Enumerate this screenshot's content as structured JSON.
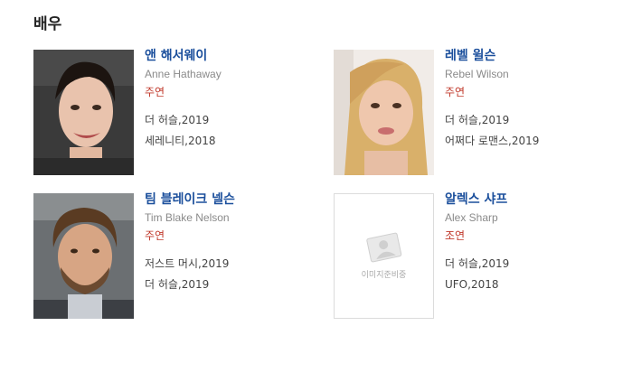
{
  "section": {
    "title": "배우"
  },
  "cast": [
    {
      "name_ko": "앤 해서웨이",
      "name_en": "Anne Hathaway",
      "role": "주연",
      "films": [
        "더 허슬,2019",
        "세레니티,2018"
      ]
    },
    {
      "name_ko": "레벨 윌슨",
      "name_en": "Rebel Wilson",
      "role": "주연",
      "films": [
        "더 허슬,2019",
        "어쩌다 로맨스,2019"
      ]
    },
    {
      "name_ko": "팀 블레이크 넬슨",
      "name_en": "Tim Blake Nelson",
      "role": "주연",
      "films": [
        "저스트 머시,2019",
        "더 허슬,2019"
      ]
    },
    {
      "name_ko": "알렉스 샤프",
      "name_en": "Alex Sharp",
      "role": "조연",
      "films": [
        "더 허슬,2019",
        "UFO,2018"
      ],
      "placeholder_text": "이미지준비중"
    }
  ]
}
